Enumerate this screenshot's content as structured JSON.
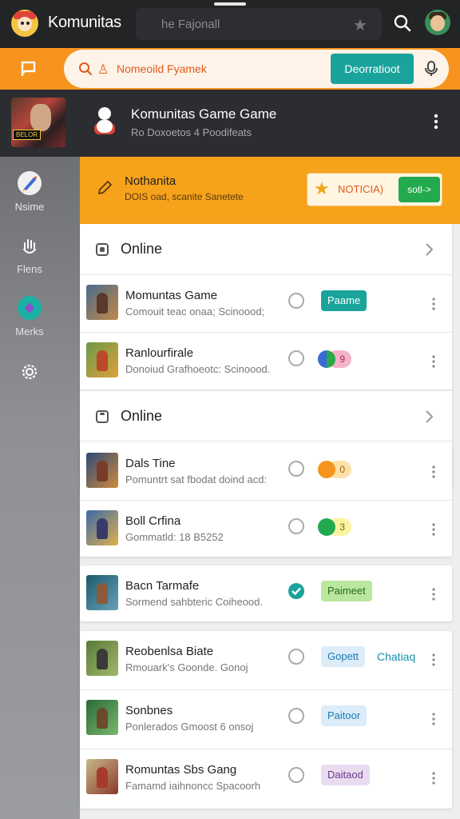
{
  "app": {
    "title": "Komunitas",
    "search_text": "he Fajonall"
  },
  "toolbar": {
    "search_text": "Nomeoild Fyamek",
    "action_label": "Deorratioot"
  },
  "community": {
    "thumb_badge": "BELOR",
    "title": "Komunitas Game Game",
    "subtitle": "Ro Doxoetos 4 Poodifeats"
  },
  "sidebar": {
    "items": [
      {
        "label": "Nsime",
        "icon": "rocket-icon"
      },
      {
        "label": "Flens",
        "icon": "hand-icon"
      },
      {
        "label": "Merks",
        "icon": "badge-icon"
      },
      {
        "label": "",
        "icon": "gear-icon"
      }
    ]
  },
  "notice": {
    "title": "Nothanita",
    "subtitle": "DOIS oad, scanite Sanetete",
    "badge_text": "NOTICIA)",
    "go_label": "sotl->"
  },
  "sections": [
    {
      "label": "Online",
      "rows": [
        {
          "title": "Momuntas Game",
          "subtitle": "Comouit teac onaa; Scinoood;",
          "pill": "Paame",
          "checked": false
        },
        {
          "title": "Ranlourfirale",
          "subtitle": "Donoiud Grafhoeotc: Scinoood.",
          "dot_value": "9",
          "checked": false
        }
      ]
    },
    {
      "label": "Online",
      "rows": [
        {
          "title": "Dals Tine",
          "subtitle": "Pomuntrt sat fbodat doind acd:",
          "dot_value": "0",
          "checked": false
        },
        {
          "title": "Boll Crfina",
          "subtitle": "Gommatld: 18 B5252",
          "dot_value": "3",
          "checked": false
        }
      ]
    }
  ],
  "single_row": {
    "title": "Bacn Tarmafe",
    "subtitle": "Sormend sahbteric Coiheood.",
    "pill": "Paimeet",
    "checked": true
  },
  "last_group": [
    {
      "title": "Reobenlsa Biate",
      "subtitle": "Rmouark's Goonde. Gonoj",
      "pill": "Gopett",
      "pill2": "Chatiaq",
      "checked": false
    },
    {
      "title": "Sonbnes",
      "subtitle": "Ponlerados Gmoost 6 onsoj",
      "pill": "Paitoor",
      "checked": false
    },
    {
      "title": "Romuntas Sbs Gang",
      "subtitle": "Famamd iaihnoncc Spacoorh",
      "pill": "Daitaod",
      "checked": false
    }
  ],
  "colors": {
    "orange": "#f7941d",
    "teal": "#1aa39a",
    "dark": "#222426",
    "green": "#23a94e"
  }
}
